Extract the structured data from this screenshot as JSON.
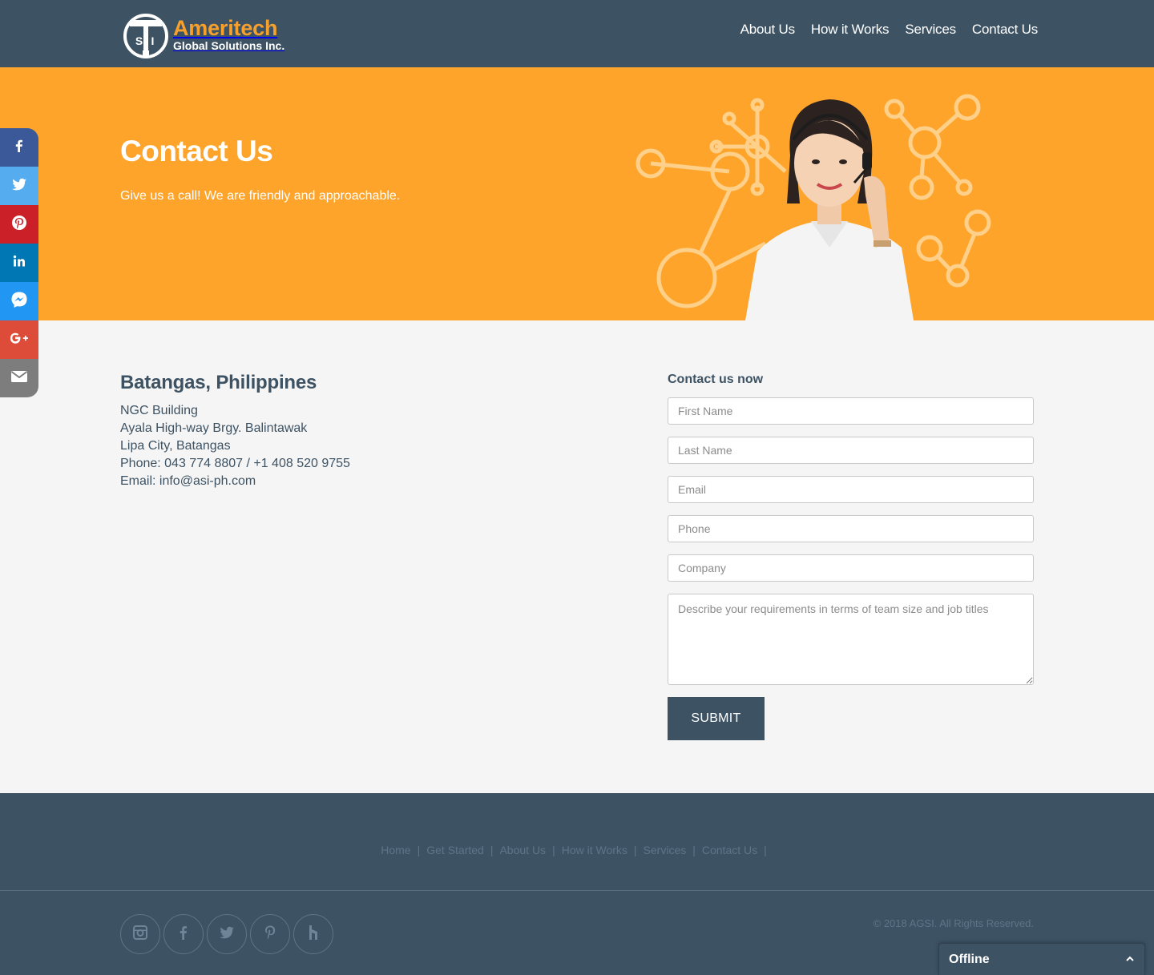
{
  "brand": {
    "name": "Ameritech",
    "sub": "Global Solutions Inc.",
    "mark_letters": "SI"
  },
  "nav": [
    {
      "label": "About Us"
    },
    {
      "label": "How it Works"
    },
    {
      "label": "Services"
    },
    {
      "label": "Contact Us"
    }
  ],
  "hero": {
    "title": "Contact Us",
    "subtitle": "Give us a call! We are friendly and approachable."
  },
  "share": [
    {
      "icon": "facebook-icon",
      "color": "#3b5998"
    },
    {
      "icon": "twitter-icon",
      "color": "#55acee"
    },
    {
      "icon": "pinterest-icon",
      "color": "#cb2027"
    },
    {
      "icon": "linkedin-icon",
      "color": "#0077b5"
    },
    {
      "icon": "messenger-icon",
      "color": "#2196f3"
    },
    {
      "icon": "google-plus-icon",
      "color": "#dd4b39"
    },
    {
      "icon": "email-icon",
      "color": "#7d7d7d"
    }
  ],
  "address": {
    "heading": "Batangas, Philippines",
    "lines": [
      "NGC Building",
      "Ayala High-way Brgy. Balintawak",
      "Lipa City, Batangas",
      "Phone: 043 774 8807 / +1 408 520 9755",
      "Email: info@asi-ph.com"
    ]
  },
  "form": {
    "title": "Contact us now",
    "first_name_placeholder": "First Name",
    "last_name_placeholder": "Last Name",
    "email_placeholder": "Email",
    "phone_placeholder": "Phone",
    "company_placeholder": "Company",
    "requirements_placeholder": "Describe your requirements in terms of team size and job titles",
    "submit_label": "SUBMIT"
  },
  "footer": {
    "links": [
      {
        "label": "Home"
      },
      {
        "label": "Get Started"
      },
      {
        "label": "About Us"
      },
      {
        "label": "How it Works"
      },
      {
        "label": "Services"
      },
      {
        "label": "Contact Us"
      }
    ],
    "separator": "|",
    "socials": [
      "instagram-icon",
      "facebook-icon",
      "twitter-icon",
      "pinterest-icon",
      "houzz-icon"
    ],
    "copyright": "© 2018 AGSI. All Rights Reserved."
  },
  "chat": {
    "status": "Offline",
    "toggle": "⌃"
  },
  "colors": {
    "header_bg": "#3d5263",
    "accent": "#fea42a",
    "brand_orange": "#f7a02c",
    "body_bg": "#f5f5f5"
  }
}
